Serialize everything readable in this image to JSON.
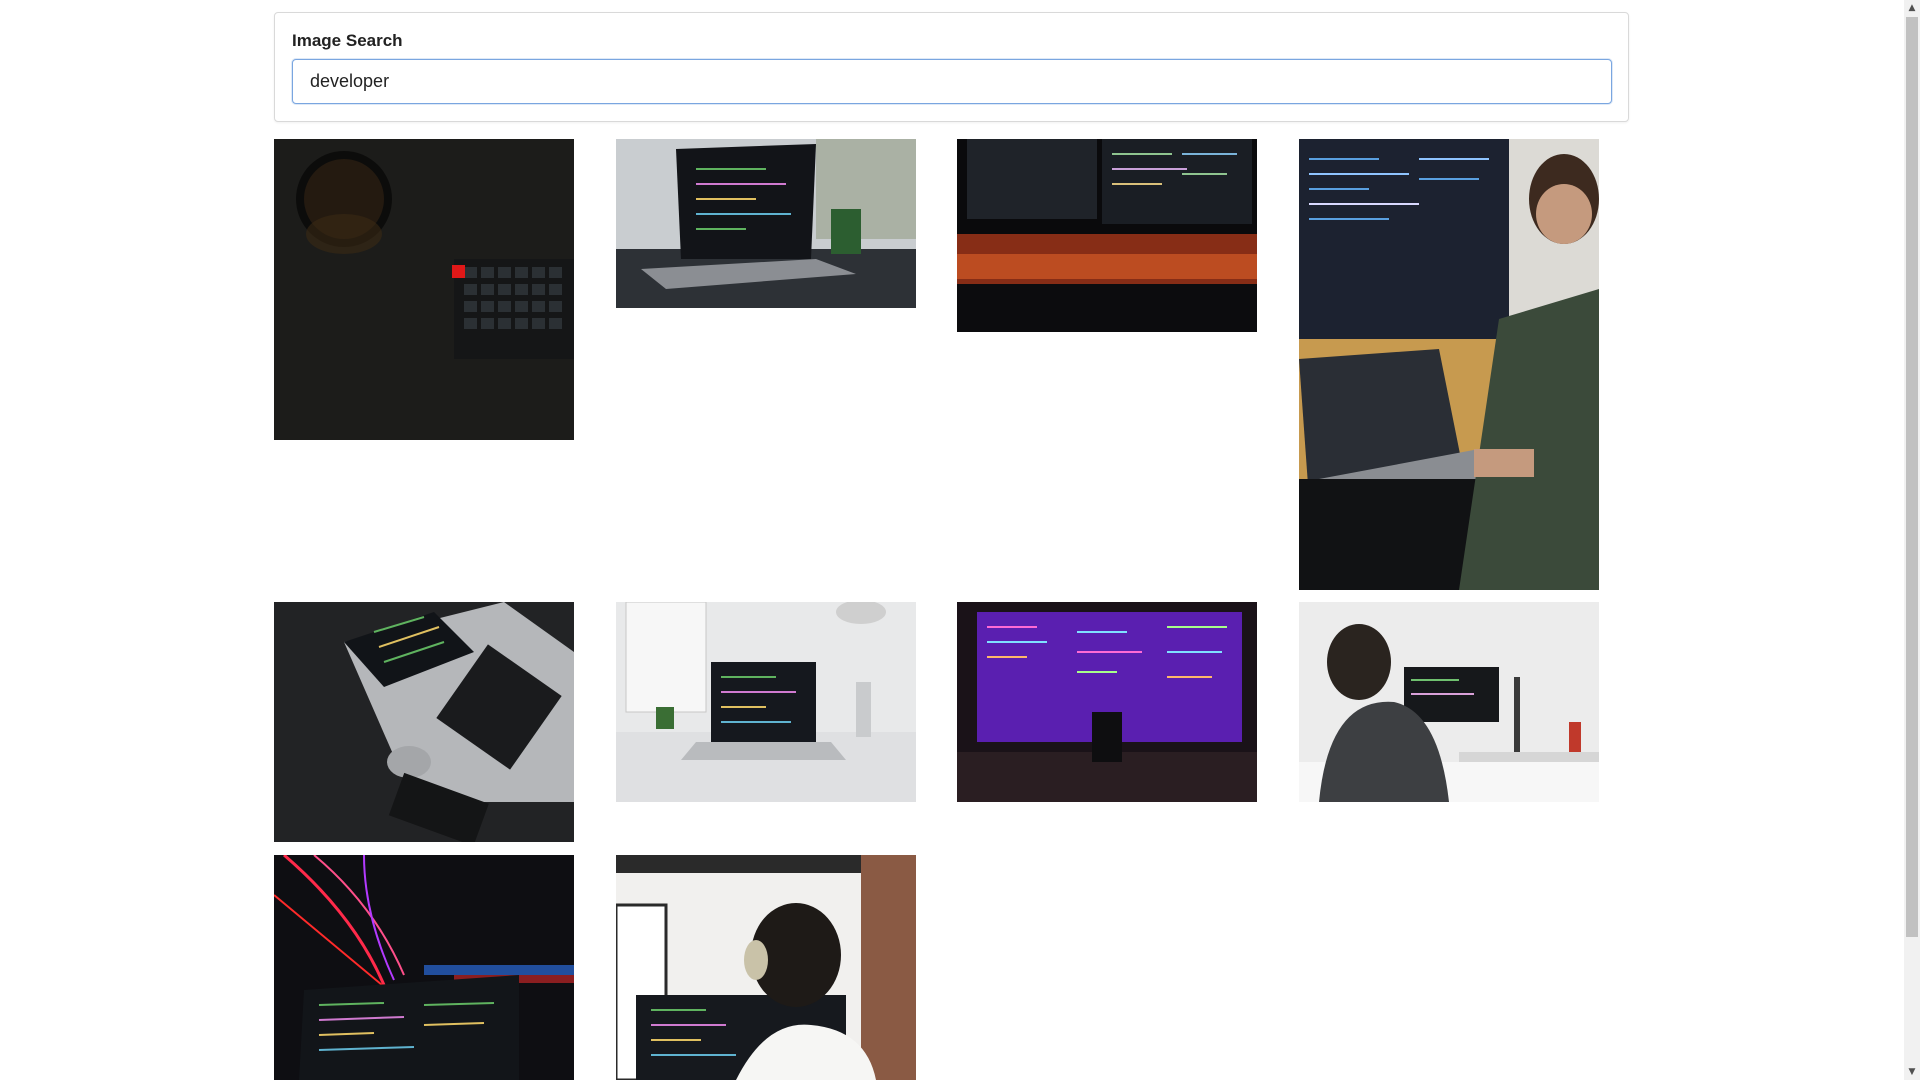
{
  "search": {
    "label": "Image Search",
    "value": "developer",
    "placeholder": ""
  },
  "results": [
    {
      "name": "coffee-keyboard-dark",
      "description": "coffee mug and mechanical keyboard on dark desk"
    },
    {
      "name": "laptop-code-plant",
      "description": "laptop with code and small plant"
    },
    {
      "name": "monitors-red-glow",
      "description": "monitors with code and red backlight"
    },
    {
      "name": "man-coding-monitor-laptop",
      "description": "man coding on monitor and laptop"
    },
    {
      "name": "laptop-overhead-dark",
      "description": "overhead laptop with code on dark desk"
    },
    {
      "name": "laptop-white-desk",
      "description": "laptop on white desk by window"
    },
    {
      "name": "purple-code-monitor",
      "description": "wide monitor with purple code and mug"
    },
    {
      "name": "man-headphones-desk",
      "description": "man with headphones at desk"
    },
    {
      "name": "code-light-trails",
      "description": "code screen with red and blue light trails"
    },
    {
      "name": "person-headphones-code",
      "description": "person wearing headphones viewing code"
    }
  ],
  "colors": {
    "input_border": "#7aa6e0",
    "card_border": "#d9d9d9"
  }
}
